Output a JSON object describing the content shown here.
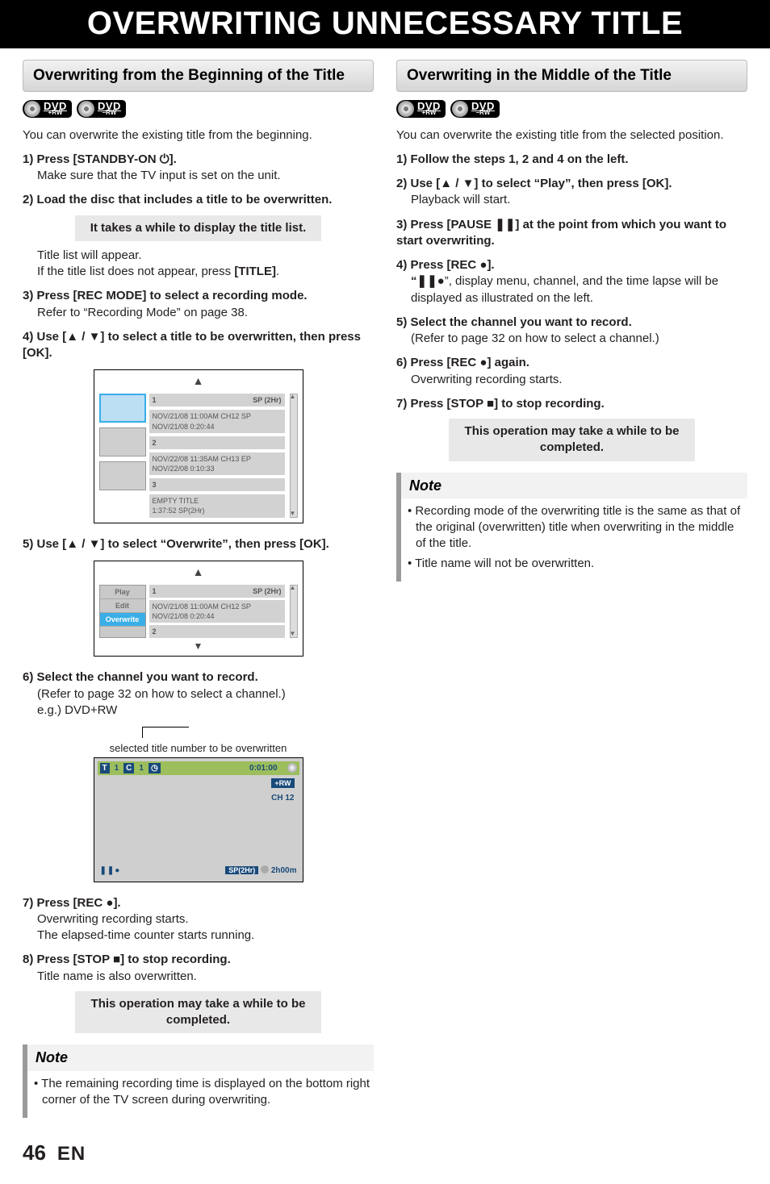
{
  "pageTitle": "OVERWRITING UNNECESSARY TITLE",
  "footer": {
    "page": "46",
    "lang": "EN"
  },
  "badges": {
    "plus": "+RW",
    "minus": "–RW",
    "dvd": "DVD"
  },
  "symbols": {
    "power": "⏻",
    "up": "▲",
    "down": "▼",
    "rec": "●",
    "stop": "■",
    "pause": "❚❚",
    "pauseRec": "❚❚●"
  },
  "left": {
    "sectionTitle": "Overwriting from the Beginning of the Title",
    "intro": "You can overwrite the existing title from the beginning.",
    "s1a": "1) Press [STANDBY-ON ",
    "s1b": "].",
    "s1sub": "Make sure that the TV input is set on the unit.",
    "s2": "2) Load the disc that includes a title to be overwritten.",
    "callout1": "It takes a while to display the title list.",
    "s2suba": "Title list will appear.",
    "s2subb_a": "If the title list does not appear, press ",
    "s2subb_b": "[TITLE]",
    "s2subb_c": ".",
    "s3": "3) Press [REC MODE] to select a recording mode.",
    "s3sub": "Refer to “Recording Mode” on page 38.",
    "s4a": "4) Use [",
    "s4b": " / ",
    "s4c": "] to select a title to be overwritten, then press [OK].",
    "s5a": "5) Use [",
    "s5b": " / ",
    "s5c": "] to select “Overwrite”, then press [OK].",
    "s6": "6) Select the channel you want to record.",
    "s6sub": "(Refer to page 32 on how to select a channel.)",
    "s6eg": "e.g.) DVD+RW",
    "caption": "selected title number to be overwritten",
    "s7a": "7) Press [REC ",
    "s7b": "].",
    "s7suba": "Overwriting recording starts.",
    "s7subb": "The elapsed-time counter starts running.",
    "s8a": "8) Press [STOP ",
    "s8b": "] to stop recording.",
    "s8sub": "Title name is also overwritten.",
    "callout2": "This operation may take a while to be completed.",
    "noteHead": "Note",
    "note1": "The remaining recording time is displayed on the bottom right corner of the TV screen during overwriting."
  },
  "right": {
    "sectionTitle": "Overwriting in the Middle of the Title",
    "intro": "You can overwrite the existing title from the selected position.",
    "s1": "1) Follow the steps 1, 2 and 4 on the left.",
    "s2a": "2) Use [",
    "s2b": " / ",
    "s2c": "] to select “Play”, then press [OK].",
    "s2sub": "Playback will start.",
    "s3a": "3) Press [PAUSE ",
    "s3b": "] at the point from which you want to start overwriting.",
    "s4a": "4) Press [REC ",
    "s4b": "].",
    "s4sub_a": "“",
    "s4sub_b": "”, display menu, channel, and the time lapse will be displayed as illustrated on the left.",
    "s5": "5) Select the channel you want to record.",
    "s5sub": "(Refer to page 32 on how to select a channel.)",
    "s6a": "6) Press [REC ",
    "s6b": "] again.",
    "s6sub": "Overwriting recording starts.",
    "s7a": "7) Press [STOP ",
    "s7b": "] to stop recording.",
    "callout": "This operation may take a while to be completed.",
    "noteHead": "Note",
    "note1": "Recording mode of the overwriting title is the same as that of the original (overwritten) title when overwriting in the middle of the title.",
    "note2": "Title name will not be overwritten."
  },
  "fig1": {
    "sp": "SP (2Hr)",
    "r1n": "1",
    "r1a": "NOV/21/08  11:00AM CH12  SP",
    "r1b": "NOV/21/08   0:20:44",
    "r2n": "2",
    "r2a": "NOV/22/08  11:35AM CH13  EP",
    "r2b": "NOV/22/08   0:10:33",
    "r3n": "3",
    "r3a": "EMPTY TITLE",
    "r3b": "1:37:52  SP(2Hr)"
  },
  "fig2": {
    "menuPlay": "Play",
    "menuEdit": "Edit",
    "menuOver": "Overwrite",
    "sp": "SP (2Hr)",
    "r1n": "1",
    "r1a": "NOV/21/08  11:00AM CH12  SP",
    "r1b": "NOV/21/08   0:20:44",
    "r2n": "2"
  },
  "tv": {
    "T": "T",
    "Tn": "1",
    "C": "C",
    "Cn": "1",
    "clk": "0:01:00",
    "rw": "+RW",
    "ch": "CH  12",
    "sp": "SP(2Hr)",
    "rem": "2h00m"
  }
}
